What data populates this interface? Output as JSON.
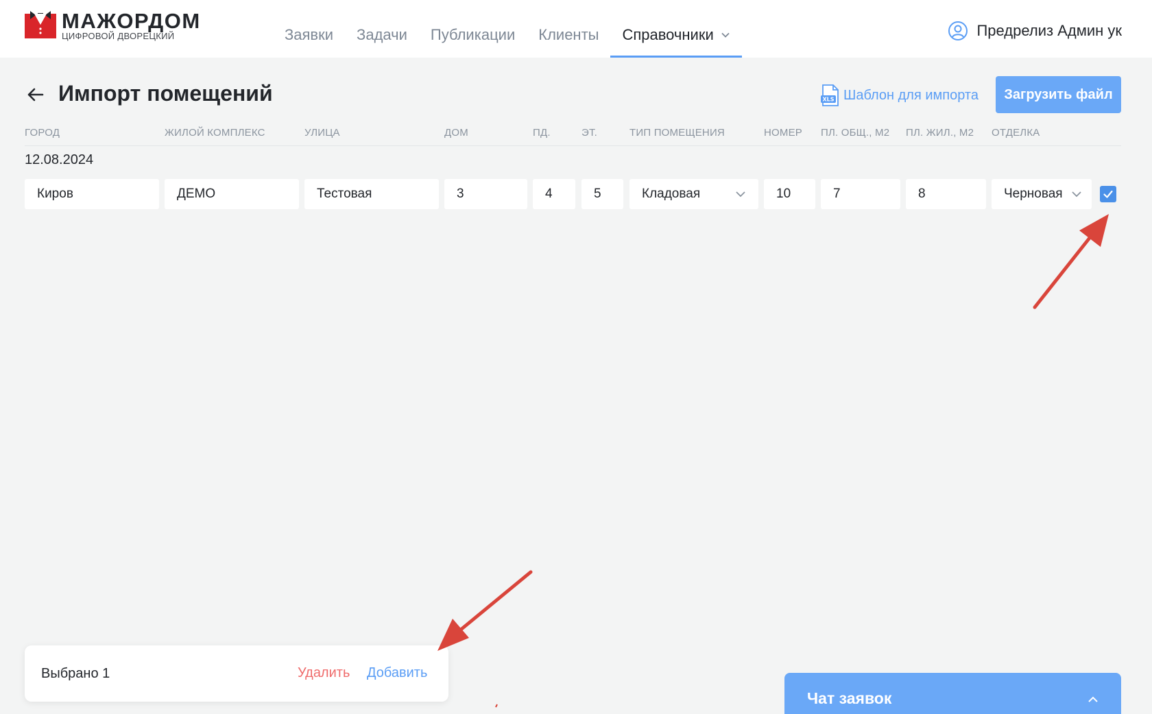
{
  "brand": {
    "title": "МАЖОРДОМ",
    "subtitle": "ЦИФРОВОЙ ДВОРЕЦКИЙ"
  },
  "nav": {
    "items": [
      {
        "label": "Заявки"
      },
      {
        "label": "Задачи"
      },
      {
        "label": "Публикации"
      },
      {
        "label": "Клиенты"
      },
      {
        "label": "Справочники",
        "active": true
      }
    ]
  },
  "user": {
    "name": "Предрелиз Админ ук"
  },
  "page": {
    "title": "Импорт помещений",
    "template_link": "Шаблон для импорта",
    "xls_label": "XLS",
    "upload_button": "Загрузить файл"
  },
  "table": {
    "headers": [
      "Город",
      "Жилой комплекс",
      "Улица",
      "Дом",
      "Пд.",
      "Эт.",
      "Тип помещения",
      "Номер",
      "Пл. общ., м2",
      "Пл. жил., м2",
      "Отделка"
    ],
    "group_date": "12.08.2024",
    "row": {
      "city": "Киров",
      "complex": "ДЕМО",
      "street": "Тестовая",
      "house": "3",
      "entrance": "4",
      "floor": "5",
      "room_type": "Кладовая",
      "number": "10",
      "area_total": "7",
      "area_living": "8",
      "finish": "Черновая",
      "checked": true
    }
  },
  "selection": {
    "count_label": "Выбрано 1",
    "delete_label": "Удалить",
    "add_label": "Добавить"
  },
  "chat": {
    "title": "Чат заявок"
  },
  "colors": {
    "accent": "#5a9df5",
    "button": "#6aa8f7",
    "danger": "#ef6b6b",
    "annotation": "#d9453b",
    "logo_red": "#d9252a"
  }
}
